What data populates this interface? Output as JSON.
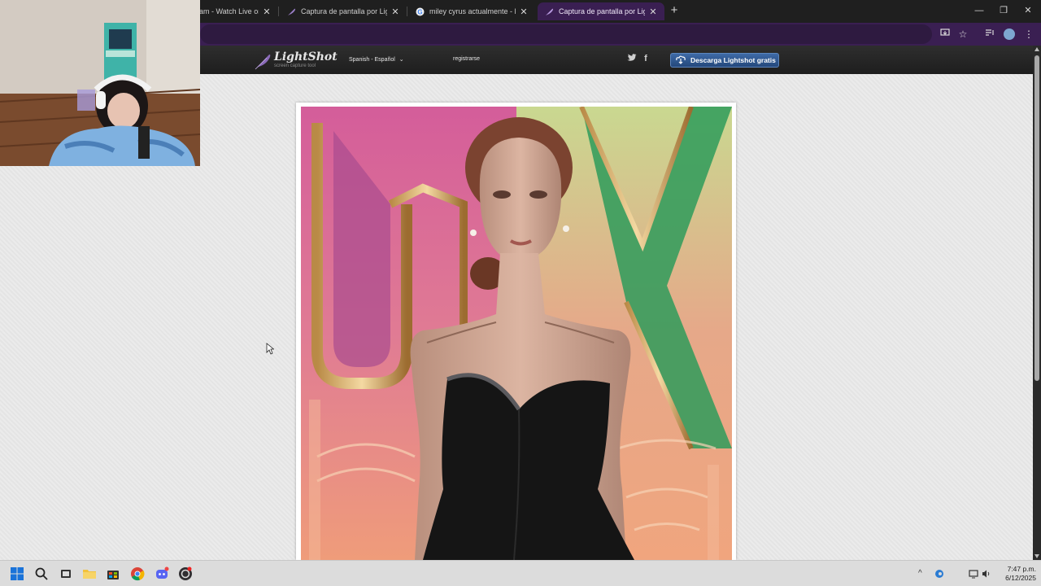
{
  "browser": {
    "tabs": [
      {
        "title": "eam - Watch Live on",
        "icon": "twitch-icon",
        "active": false
      },
      {
        "title": "Captura de pantalla por Lightsh",
        "icon": "feather-icon",
        "active": false
      },
      {
        "title": "miley cyrus actualmente - Busc",
        "icon": "google-icon",
        "active": false
      },
      {
        "title": "Captura de pantalla por Lightsh",
        "icon": "feather-icon",
        "active": true
      }
    ],
    "new_tab": "+",
    "window_controls": {
      "minimize": "—",
      "restore": "❐",
      "close": "✕"
    },
    "accent": "#3a1f52"
  },
  "lightshot": {
    "logo_name": "LightShot",
    "logo_tagline": "screen capture tool",
    "language": "Spanish - Español",
    "language_caret": "⌄",
    "register": "registrarse",
    "twitter": "t",
    "facebook": "f",
    "download_button": "Descarga Lightshot gratis"
  },
  "taskbar": {
    "time": "7:47 p.m.",
    "date": "6/12/2025",
    "tray_arrow": "^"
  }
}
